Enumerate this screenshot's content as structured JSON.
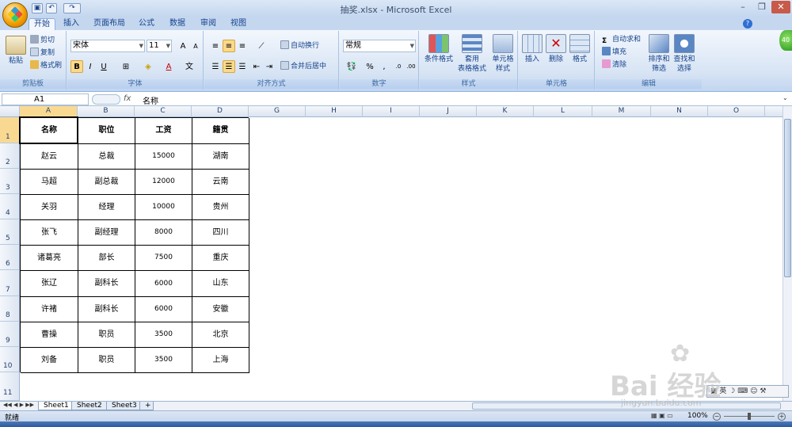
{
  "window": {
    "title": "抽奖.xlsx - Microsoft Excel"
  },
  "tabs": [
    "开始",
    "插入",
    "页面布局",
    "公式",
    "数据",
    "审阅",
    "视图"
  ],
  "ribbon": {
    "clipboard": {
      "label": "剪贴板",
      "paste": "粘贴",
      "cut": "剪切",
      "copy": "复制",
      "format_painter": "格式刷"
    },
    "font": {
      "label": "字体",
      "name": "宋体",
      "size": "11"
    },
    "alignment": {
      "label": "对齐方式",
      "wrap": "自动换行",
      "merge": "合并后居中"
    },
    "number": {
      "label": "数字",
      "format": "常规"
    },
    "styles": {
      "label": "样式",
      "conditional": "条件格式",
      "table1": "套用",
      "table2": "表格格式",
      "cell1": "单元格",
      "cell2": "样式"
    },
    "cells": {
      "label": "单元格",
      "insert": "插入",
      "delete": "删除",
      "format": "格式"
    },
    "editing": {
      "label": "编辑",
      "autosum": "自动求和",
      "fill": "填充",
      "clear": "清除",
      "sort1": "排序和",
      "sort2": "筛选",
      "find1": "查找和",
      "find2": "选择"
    }
  },
  "formula_bar": {
    "name_box": "A1",
    "fx": "fx",
    "value": "名称"
  },
  "columns": [
    "A",
    "B",
    "C",
    "D",
    "G",
    "H",
    "I",
    "J",
    "K",
    "L",
    "M",
    "N",
    "O"
  ],
  "rows": [
    "1",
    "2",
    "3",
    "4",
    "5",
    "6",
    "7",
    "8",
    "9",
    "10",
    "11"
  ],
  "table": {
    "headers": [
      "名称",
      "职位",
      "工资",
      "籍贯"
    ],
    "rows": [
      [
        "赵云",
        "总裁",
        "15000",
        "湖南"
      ],
      [
        "马超",
        "副总裁",
        "12000",
        "云南"
      ],
      [
        "关羽",
        "经理",
        "10000",
        "贵州"
      ],
      [
        "张飞",
        "副经理",
        "8000",
        "四川"
      ],
      [
        "诸葛亮",
        "部长",
        "7500",
        "重庆"
      ],
      [
        "张辽",
        "副科长",
        "6000",
        "山东"
      ],
      [
        "许褚",
        "副科长",
        "6000",
        "安徽"
      ],
      [
        "曹操",
        "职员",
        "3500",
        "北京"
      ],
      [
        "刘备",
        "职员",
        "3500",
        "上海"
      ]
    ]
  },
  "sheets": [
    "Sheet1",
    "Sheet2",
    "Sheet3"
  ],
  "status": {
    "ready": "就绪",
    "zoom": "100%"
  },
  "ime": {
    "lang": "英"
  },
  "watermark": {
    "text": "Bai 经验",
    "url": "jingyan.baidu.com"
  },
  "colors": {
    "ribbon": "#dbe7f6",
    "selection": "#f9d992",
    "accent": "#15428b"
  }
}
